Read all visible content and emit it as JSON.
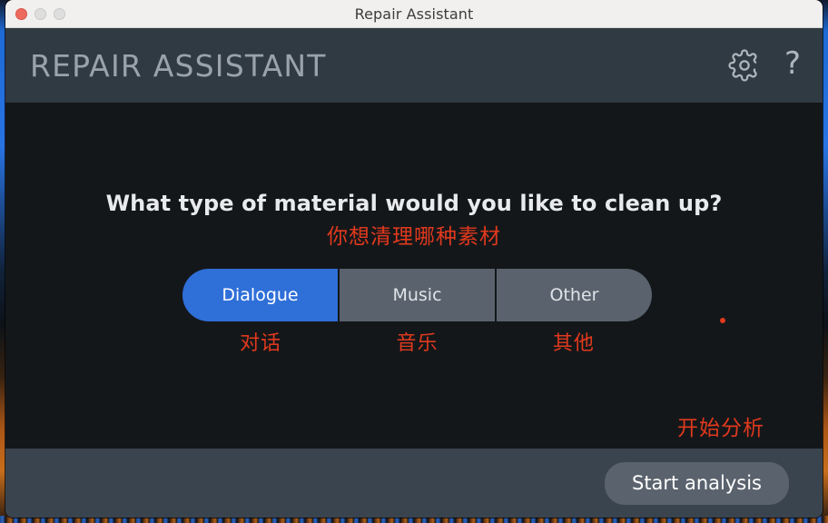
{
  "window": {
    "title": "Repair Assistant",
    "traffic_lights": [
      {
        "name": "close",
        "color": "#ee6a5f"
      },
      {
        "name": "minimize",
        "color": "#dedede"
      },
      {
        "name": "zoom",
        "color": "#dedede"
      }
    ]
  },
  "header": {
    "app_title": "REPAIR ASSISTANT",
    "settings_icon": "gear-icon",
    "help_icon": "question-mark-icon",
    "help_glyph": "?",
    "background": "#303a43",
    "title_color": "#9aa3ac"
  },
  "main": {
    "question_en": "What type of material would you like to clean up?",
    "question_zh": "你想清理哪种素材",
    "segmented_control": {
      "selected": "Dialogue",
      "options": [
        {
          "label": "Dialogue",
          "label_zh": "对话",
          "selected": true
        },
        {
          "label": "Music",
          "label_zh": "音乐",
          "selected": false
        },
        {
          "label": "Other",
          "label_zh": "其他",
          "selected": false
        }
      ]
    },
    "marker_dot": "red-dot-annotation"
  },
  "footer": {
    "start_label": "Start analysis",
    "start_label_zh": "开始分析"
  },
  "colors": {
    "accent_blue": "#2f6fd8",
    "annotation_red": "#e0391d",
    "segment_gray": "#5a636d",
    "body_background": "#14171a",
    "footer_background": "#3a444e",
    "titlebar_background": "#f2f0ee"
  }
}
